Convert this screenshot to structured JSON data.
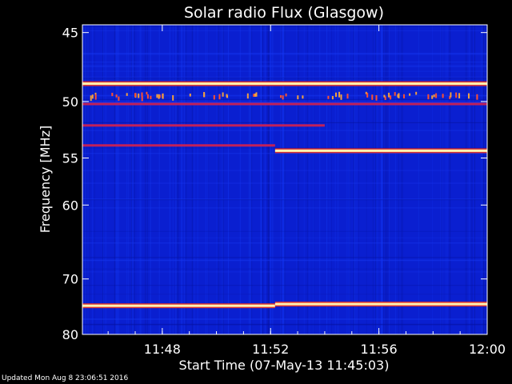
{
  "chart_data": {
    "type": "heatmap",
    "title": "Solar radio Flux (Glasgow)",
    "xlabel": "Start Time (07-May-13 11:45:03)",
    "ylabel": "Frequency [MHz]",
    "x_range": [
      "11:45:03",
      "12:00:00"
    ],
    "x_ticks": [
      "11:48",
      "11:52",
      "11:56",
      "12:00"
    ],
    "y_range": [
      44.5,
      80
    ],
    "y_scale": "reciprocal",
    "y_ticks": [
      45,
      50,
      55,
      60,
      70,
      80
    ],
    "colors": {
      "background": "#000000",
      "low": "#0a1fd0",
      "mid": "#c0205a",
      "high": "#fff2b0"
    },
    "emission_lines": [
      {
        "freq": 48.6,
        "start": "11:45:03",
        "end": "12:00:00",
        "level": "high"
      },
      {
        "freq": 50.2,
        "start": "11:45:03",
        "end": "12:00:00",
        "level": "mid"
      },
      {
        "freq": 52.0,
        "start": "11:45:03",
        "end": "11:54:00",
        "level": "mid"
      },
      {
        "freq": 53.8,
        "start": "11:45:03",
        "end": "11:52:10",
        "level": "mid"
      },
      {
        "freq": 54.3,
        "start": "11:52:10",
        "end": "12:00:00",
        "level": "high"
      },
      {
        "freq": 74.5,
        "start": "11:45:03",
        "end": "11:52:10",
        "level": "high"
      },
      {
        "freq": 74.2,
        "start": "11:52:10",
        "end": "12:00:00",
        "level": "high"
      }
    ],
    "footer": "Updated Mon Aug  8 23:06:51 2016"
  }
}
